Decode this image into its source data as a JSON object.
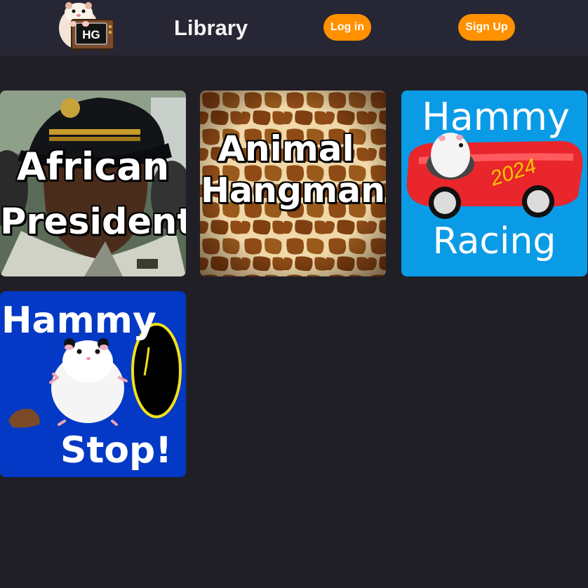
{
  "header": {
    "logo_text": "HG",
    "title": "Library",
    "login_label": "Log in",
    "signup_label": "Sign Up"
  },
  "colors": {
    "page_background": "#211f26",
    "header_background": "#272634",
    "accent_button": "#ff9100"
  },
  "games": [
    {
      "line1": "African",
      "line2": "President"
    },
    {
      "line1": "Animal",
      "line2": "Hangman"
    },
    {
      "line1": "Hammy",
      "line2": "Racing",
      "badge": "2024"
    },
    {
      "line1": "Hammy",
      "line2": "Stop!"
    }
  ]
}
